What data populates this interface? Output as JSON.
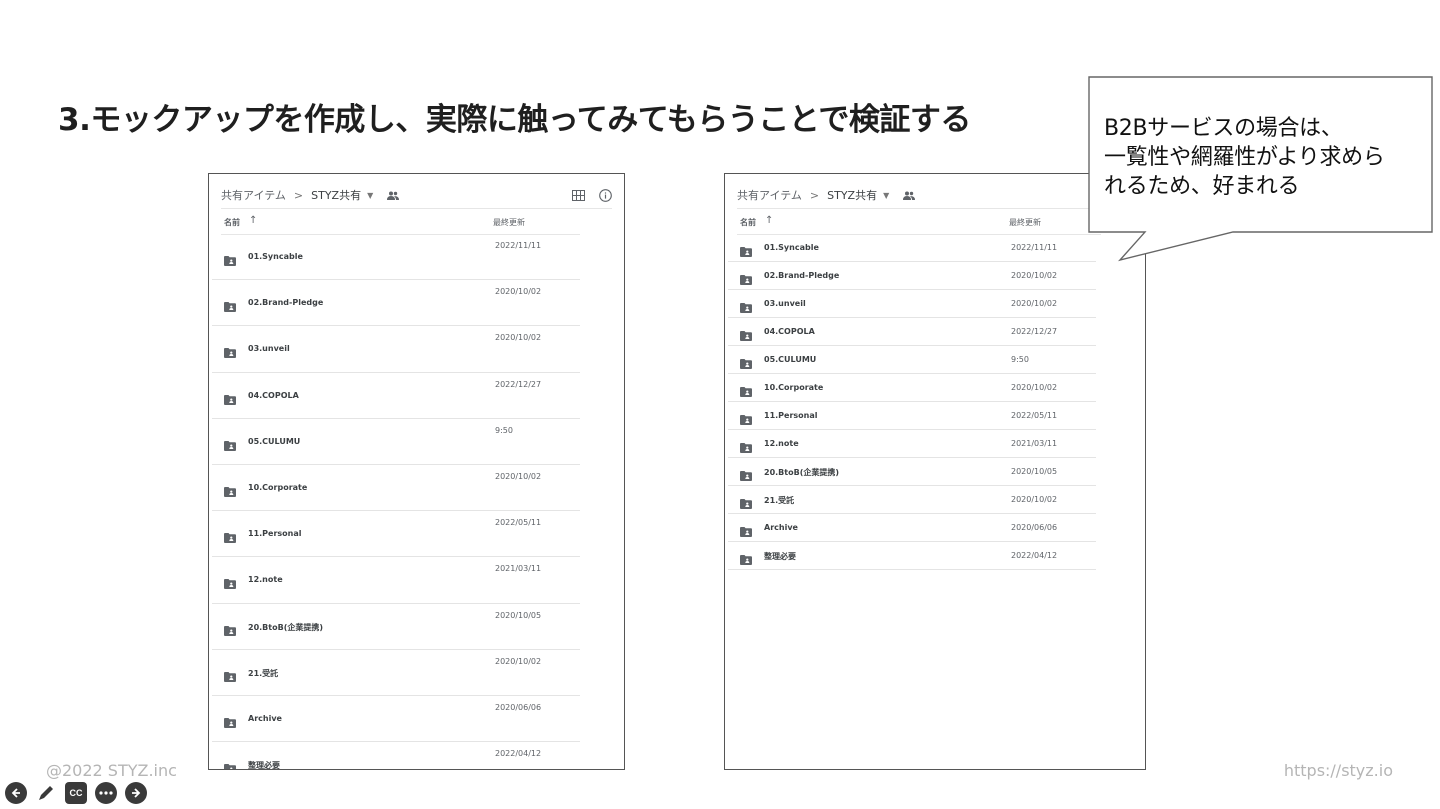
{
  "slide": {
    "title": "3.モックアップを作成し、実際に触ってみてもらうことで検証する"
  },
  "callout": {
    "lines": [
      "B2Bサービスの場合は、",
      "一覧性や網羅性がより求めら",
      "れるため、好まれる"
    ]
  },
  "drive": {
    "breadcrumb_root": "共有アイテム",
    "breadcrumb_sep": ">",
    "breadcrumb_current": "STYZ共有",
    "col_name": "名前",
    "col_sort": "↑",
    "col_modified": "最終更新"
  },
  "left_list": [
    {
      "name": "01.Syncable",
      "date": "2022/11/11"
    },
    {
      "name": "02.Brand-Pledge",
      "date": "2020/10/02"
    },
    {
      "name": "03.unveil",
      "date": "2020/10/02"
    },
    {
      "name": "04.COPOLA",
      "date": "2022/12/27"
    },
    {
      "name": "05.CULUMU",
      "date": "9:50"
    },
    {
      "name": "10.Corporate",
      "date": "2020/10/02"
    },
    {
      "name": "11.Personal",
      "date": "2022/05/11"
    },
    {
      "name": "12.note",
      "date": "2021/03/11"
    },
    {
      "name": "20.BtoB(企業提携)",
      "date": "2020/10/05"
    },
    {
      "name": "21.受託",
      "date": "2020/10/02"
    },
    {
      "name": "Archive",
      "date": "2020/06/06"
    },
    {
      "name": "整理必要",
      "date": "2022/04/12"
    }
  ],
  "right_list": [
    {
      "name": "01.Syncable",
      "date": "2022/11/11"
    },
    {
      "name": "02.Brand-Pledge",
      "date": "2020/10/02"
    },
    {
      "name": "03.unveil",
      "date": "2020/10/02"
    },
    {
      "name": "04.COPOLA",
      "date": "2022/12/27"
    },
    {
      "name": "05.CULUMU",
      "date": "9:50"
    },
    {
      "name": "10.Corporate",
      "date": "2020/10/02"
    },
    {
      "name": "11.Personal",
      "date": "2022/05/11"
    },
    {
      "name": "12.note",
      "date": "2021/03/11"
    },
    {
      "name": "20.BtoB(企業提携)",
      "date": "2020/10/05"
    },
    {
      "name": "21.受託",
      "date": "2020/10/02"
    },
    {
      "name": "Archive",
      "date": "2020/06/06"
    },
    {
      "name": "整理必要",
      "date": "2022/04/12"
    }
  ],
  "footer": {
    "copyright": "@2022 STYZ.inc",
    "url": "https://styz.io"
  },
  "player": {
    "icons": [
      "back-icon",
      "pen-icon",
      "captions-icon",
      "more-icon",
      "forward-icon"
    ],
    "cc_label": "CC"
  },
  "colors": {
    "panel_border": "#555555",
    "footer_text": "#b5b5b5",
    "folder_icon": "#5f6368"
  }
}
